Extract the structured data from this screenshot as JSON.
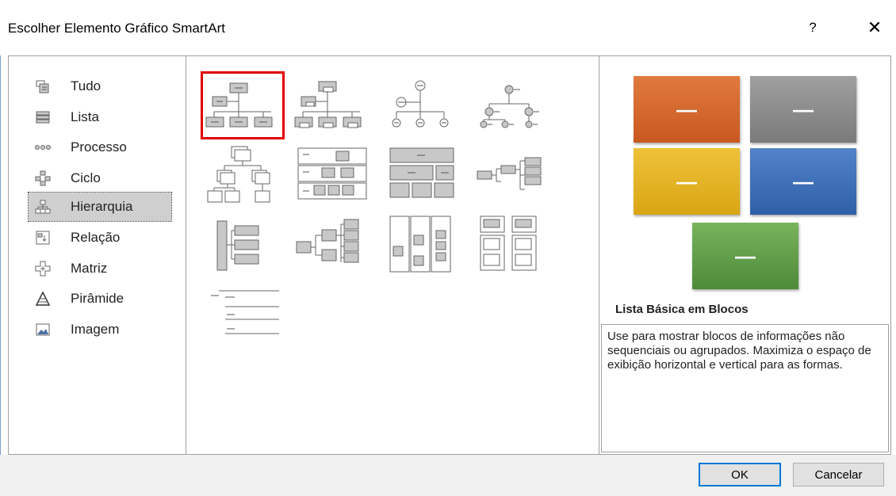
{
  "dialog": {
    "title": "Escolher Elemento Gráfico SmartArt",
    "help_label": "?",
    "close_label": "✕"
  },
  "categories": [
    {
      "label": "Tudo",
      "icon": "all-icon"
    },
    {
      "label": "Lista",
      "icon": "list-icon"
    },
    {
      "label": "Processo",
      "icon": "process-icon"
    },
    {
      "label": "Ciclo",
      "icon": "cycle-icon"
    },
    {
      "label": "Hierarquia",
      "icon": "hierarchy-icon",
      "selected": true
    },
    {
      "label": "Relação",
      "icon": "relationship-icon"
    },
    {
      "label": "Matriz",
      "icon": "matrix-icon"
    },
    {
      "label": "Pirâmide",
      "icon": "pyramid-icon"
    },
    {
      "label": "Imagem",
      "icon": "picture-icon"
    }
  ],
  "gallery": {
    "selected_index": 0,
    "count": 13
  },
  "preview": {
    "title": "Lista Básica em Blocos",
    "block_label": "—",
    "block_colors": [
      "#d9692c",
      "#8c8c8c",
      "#e3b31e",
      "#3f6fb6",
      "#5f9a4a"
    ],
    "description": "Use para mostrar blocos de informações não sequenciais ou agrupados. Maximiza o espaço de exibição horizontal e vertical para as formas."
  },
  "footer": {
    "ok_label": "OK",
    "cancel_label": "Cancelar"
  }
}
